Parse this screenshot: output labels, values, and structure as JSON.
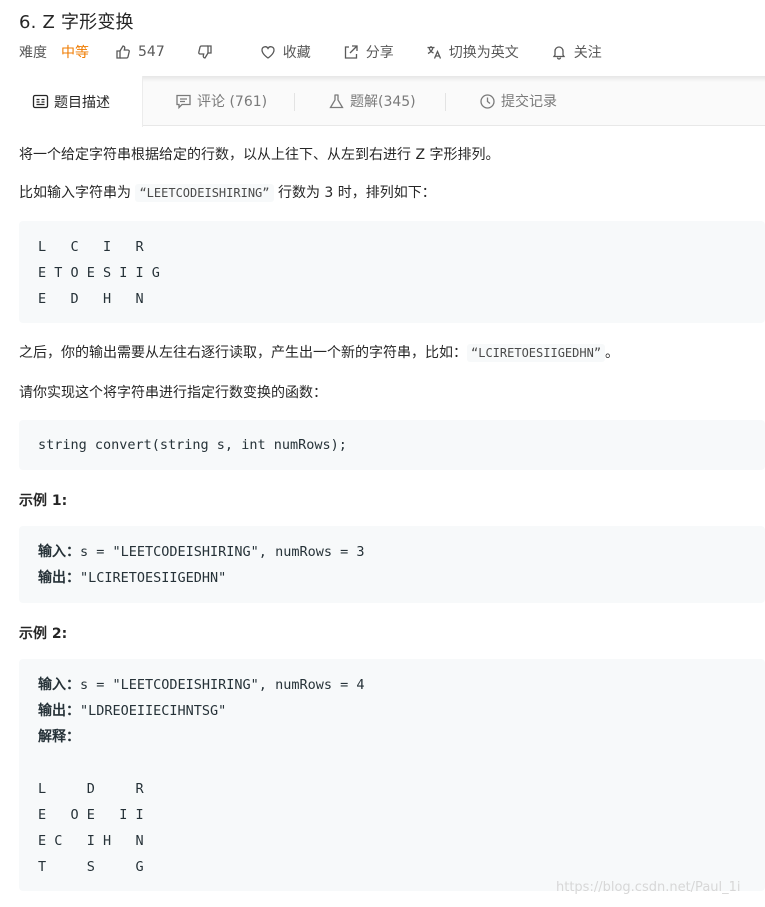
{
  "problem": {
    "title": "6. Z 字形变换",
    "difficulty_label": "难度",
    "difficulty": "中等",
    "likes": "547",
    "favorite_label": "收藏",
    "share_label": "分享",
    "switch_lang_label": "切换为英文",
    "follow_label": "关注"
  },
  "tabs": [
    {
      "label": "题目描述"
    },
    {
      "label": "评论 (761)"
    },
    {
      "label": "题解(345)"
    },
    {
      "label": "提交记录"
    }
  ],
  "description": {
    "p1": "将一个给定字符串根据给定的行数，以从上往下、从左到右进行 Z 字形排列。",
    "p2_before": "比如输入字符串为",
    "p2_code": "“LEETCODEISHIRING”",
    "p2_after": "行数为 3 时，排列如下：",
    "pattern1": [
      "L   C   I   R",
      "E T O E S I I G",
      "E   D   H   N"
    ],
    "p3_before": "之后，你的输出需要从左往右逐行读取，产生出一个新的字符串，比如：",
    "p3_code": "“LCIRETOESIIGEDHN”",
    "p3_after": "。",
    "p4": "请你实现这个将字符串进行指定行数变换的函数：",
    "signature": "string convert(string s, int numRows);"
  },
  "examples": [
    {
      "heading": "示例 1:",
      "input_label": "输入：",
      "input": "s = \"LEETCODEISHIRING\", numRows = 3",
      "output_label": "输出：",
      "output": "\"LCIRETOESIIGEDHN\""
    },
    {
      "heading": "示例 2:",
      "input_label": "输入：",
      "input": "s = \"LEETCODEISHIRING\", numRows = 4",
      "output_label": "输出：",
      "output": "\"LDREOEIIECIHNTSG\"",
      "explain_label": "解释：",
      "pattern": [
        "L     D     R",
        "E   O E   I I",
        "E C   I H   N",
        "T     S     G"
      ]
    }
  ],
  "watermark": "https://blog.csdn.net/Paul_1i"
}
